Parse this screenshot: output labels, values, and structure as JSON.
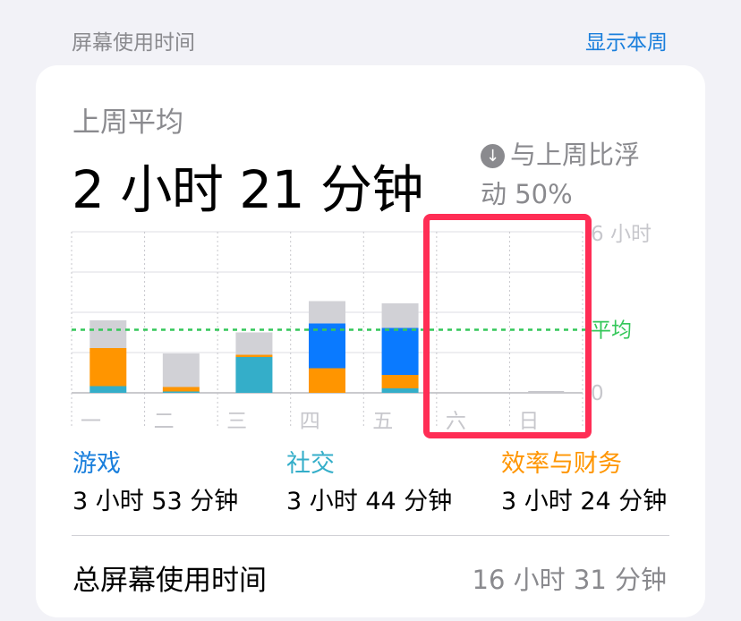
{
  "header": {
    "title": "屏幕使用时间",
    "show_week": "显示本周"
  },
  "summary": {
    "label": "上周平均",
    "value": "2 小时 21 分钟",
    "compare_line1": "与上周比浮",
    "compare_line2": "动 50%"
  },
  "chart_data": {
    "type": "bar",
    "categories": [
      "一",
      "二",
      "三",
      "四",
      "五",
      "六",
      "日"
    ],
    "y_unit": "minutes",
    "ylim": [
      0,
      360
    ],
    "y_tick_labels": [
      "6 小时",
      "平均",
      "0"
    ],
    "average": 141,
    "series": [
      {
        "name": "社交",
        "color": "#34aec9",
        "values": [
          15,
          3,
          80,
          0,
          10,
          0,
          0
        ]
      },
      {
        "name": "效率与财务",
        "color": "#ff9500",
        "values": [
          85,
          10,
          5,
          55,
          30,
          0,
          0
        ]
      },
      {
        "color": "#0a7aff",
        "values": [
          0,
          0,
          0,
          100,
          105,
          0,
          0
        ]
      },
      {
        "color": "#d1d1d6",
        "values": [
          62,
          75,
          50,
          50,
          55,
          0,
          0
        ]
      }
    ]
  },
  "categories": [
    {
      "name": "游戏",
      "time": "3 小时 53 分钟",
      "color": "#1a7fdc"
    },
    {
      "name": "社交",
      "time": "3 小时 44 分钟",
      "color": "#34aec9"
    },
    {
      "name": "效率与财务",
      "time": "3 小时 24 分钟",
      "color": "#ff9500"
    }
  ],
  "total": {
    "label": "总屏幕使用时间",
    "value": "16 小时 31 分钟"
  },
  "colors": {
    "average_line": "#34c759",
    "highlight": "#ff2d55"
  }
}
